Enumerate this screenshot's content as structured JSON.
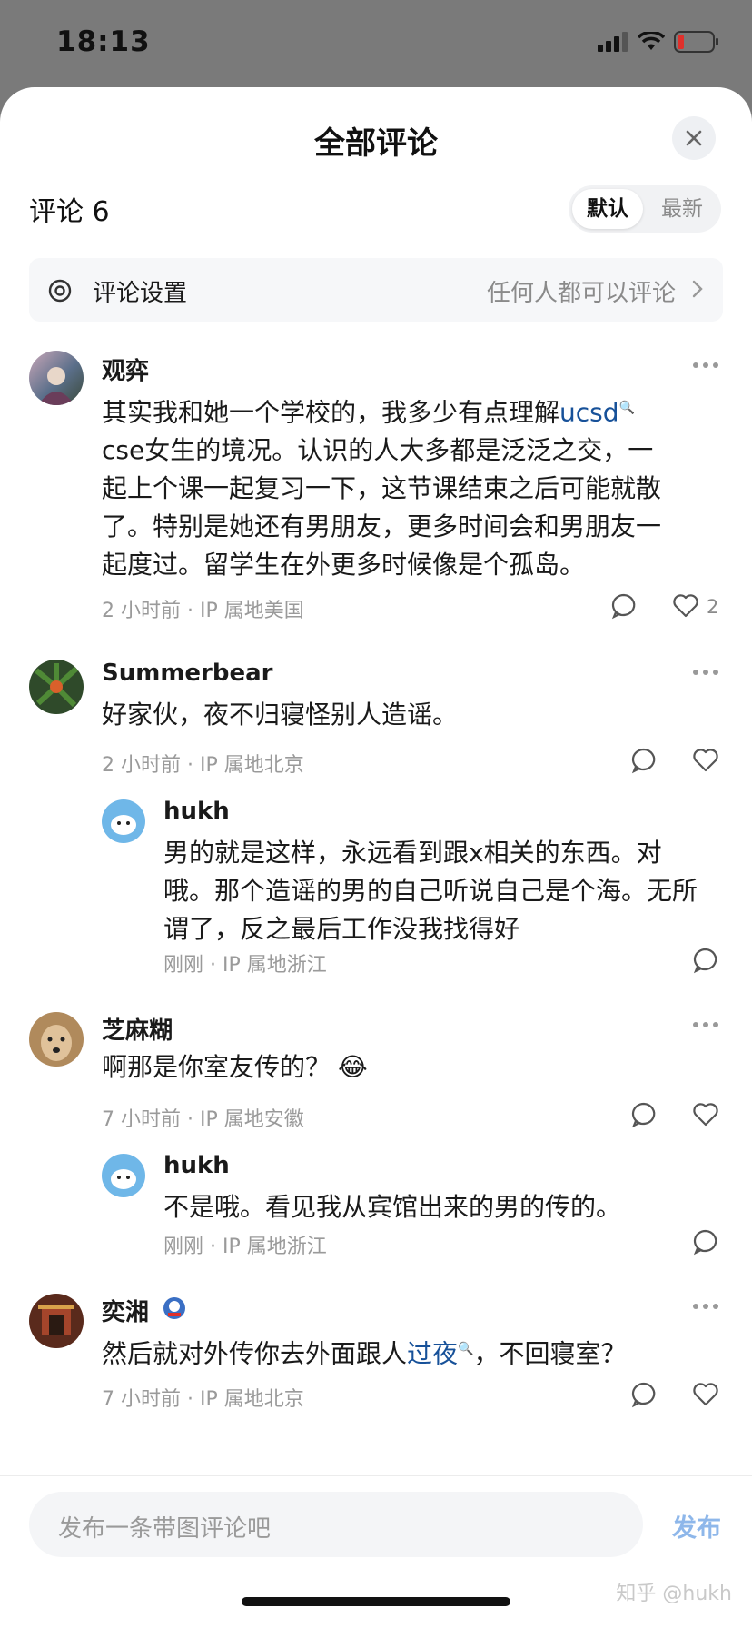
{
  "status_bar": {
    "time": "18:13"
  },
  "sheet": {
    "title": "全部评论"
  },
  "header": {
    "comment_count": "评论 6",
    "sort_options": [
      "默认",
      "最新"
    ],
    "selected_sort": "默认"
  },
  "settings": {
    "label": "评论设置",
    "value": "任何人都可以评论"
  },
  "comments": [
    {
      "name": "观弈",
      "lines": [
        "其实我和她一个学校的，我多少有点理解",
        "cse女生的境况。认识的人大多都是泛泛之交，一",
        "起上个课一起复习一下，这节课结束之后可能就散",
        "了。特别是她还有男朋友，更多时间会和男朋友一",
        "起度过。留学生在外更多时候像是个孤岛。"
      ],
      "link": "ucsd",
      "meta": "2 小时前 · IP 属地美国",
      "likes": "2"
    },
    {
      "name": "Summerbear",
      "text": "好家伙，夜不归寝怪别人造谣。",
      "meta": "2 小时前 · IP 属地北京",
      "reply": {
        "name": "hukh",
        "lines": [
          "男的就是这样，永远看到跟x相关的东西。对",
          "哦。那个造谣的男的自己听说自己是个海。无所",
          "谓了，反之最后工作没我找得好"
        ],
        "meta": "刚刚 · IP 属地浙江"
      }
    },
    {
      "name": "芝麻糊",
      "text": "啊那是你室友传的？",
      "emoji": "😂",
      "meta": "7 小时前 · IP 属地安徽",
      "reply": {
        "name": "hukh",
        "text": "不是哦。看见我从宾馆出来的男的传的。",
        "meta": "刚刚 · IP 属地浙江"
      }
    },
    {
      "name": "奕湘",
      "text_before": "然后就对外传你去外面跟人",
      "link": "过夜",
      "text_after": "，不回寝室？",
      "meta": "7 小时前 · IP 属地北京"
    }
  ],
  "footer": {
    "input_placeholder": "发布一条带图评论吧",
    "publish_label": "发布",
    "watermark": "知乎 @hukh"
  }
}
